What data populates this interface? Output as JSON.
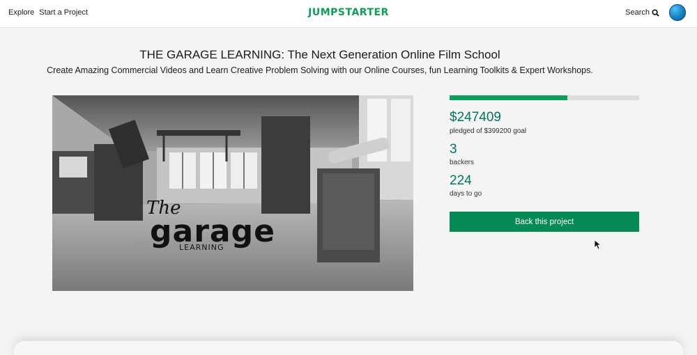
{
  "nav": {
    "explore": "Explore",
    "start_project": "Start a Project",
    "search": "Search"
  },
  "brand": {
    "logo": "JUMPSTARTER",
    "accent_color": "#0a9f5a"
  },
  "project": {
    "title": "THE GARAGE LEARNING: The Next Generation Online Film School",
    "subtitle": "Create Amazing Commercial Videos and Learn Creative Problem Solving with our Online Courses, fun Learning Toolkits & Expert Workshops.",
    "image": {
      "logo_script": "The",
      "logo_word": "garage",
      "logo_sub": "LEARNING"
    }
  },
  "funding": {
    "progress_fraction": 0.62,
    "pledged": "$247409",
    "pledged_label": "pledged of $399200 goal",
    "backers": "3",
    "backers_label": "backers",
    "days": "224",
    "days_label": "days to go"
  },
  "actions": {
    "back_button": "Back this project"
  },
  "icons": {
    "search": "search-icon",
    "avatar": "globe-avatar",
    "cursor": "mouse-pointer-icon"
  }
}
